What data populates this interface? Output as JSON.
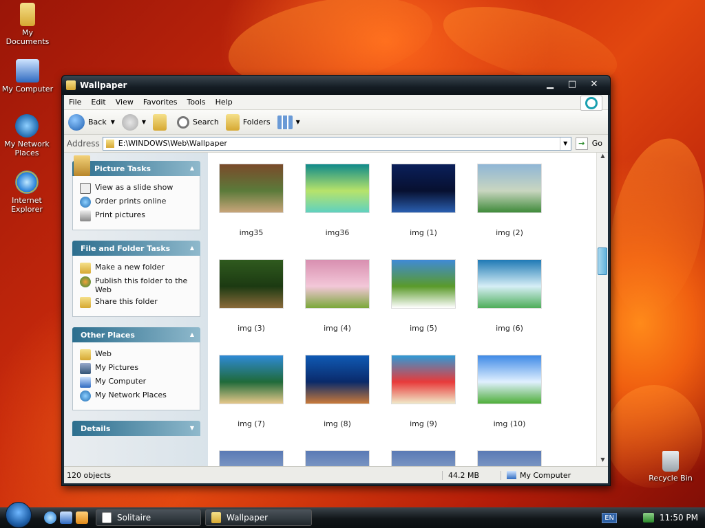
{
  "desktop": {
    "icons": [
      {
        "label": "My Documents",
        "icon": "folder-documents-icon"
      },
      {
        "label": "My Computer",
        "icon": "computer-icon"
      },
      {
        "label": "My Network Places",
        "icon": "network-icon"
      },
      {
        "label": "Internet Explorer",
        "icon": "internet-explorer-icon"
      },
      {
        "label": "Recycle Bin",
        "icon": "recycle-bin-icon"
      }
    ]
  },
  "window": {
    "title": "Wallpaper",
    "controls": {
      "minimize": "▁",
      "maximize": "□",
      "close": "✕"
    }
  },
  "menu": [
    "File",
    "Edit",
    "View",
    "Favorites",
    "Tools",
    "Help"
  ],
  "toolbar": {
    "back": "Back",
    "search": "Search",
    "folders": "Folders"
  },
  "address": {
    "label": "Address",
    "path": "E:\\WINDOWS\\Web\\Wallpaper",
    "go": "Go"
  },
  "panels": {
    "picture_tasks": {
      "title": "Picture Tasks",
      "items": [
        "View as a slide show",
        "Order prints online",
        "Print pictures"
      ]
    },
    "file_folder_tasks": {
      "title": "File and Folder Tasks",
      "items": [
        "Make a new folder",
        "Publish this folder to the Web",
        "Share this folder"
      ]
    },
    "other_places": {
      "title": "Other Places",
      "items": [
        "Web",
        "My Pictures",
        "My Computer",
        "My Network Places"
      ]
    },
    "details": {
      "title": "Details"
    }
  },
  "thumbnails": [
    {
      "name": "img35",
      "colors": [
        "#7a4a2a",
        "#c9a57a",
        "#5b7a3a"
      ]
    },
    {
      "name": "img36",
      "colors": [
        "#0f8a8a",
        "#5fd1c0",
        "#b7e36a"
      ]
    },
    {
      "name": "img (1)",
      "colors": [
        "#0a1f5a",
        "#2a5fb0",
        "#071030"
      ]
    },
    {
      "name": "img (2)",
      "colors": [
        "#8fb6d6",
        "#3f8a3a",
        "#c9d6c0"
      ]
    },
    {
      "name": "img (3)",
      "colors": [
        "#2f5a1e",
        "#8a6a3a",
        "#1c3a12"
      ]
    },
    {
      "name": "img (4)",
      "colors": [
        "#d88fb0",
        "#7aa83a",
        "#f3c7d8"
      ]
    },
    {
      "name": "img (5)",
      "colors": [
        "#3f8ad6",
        "#ffffff",
        "#5a9a2a"
      ]
    },
    {
      "name": "img (6)",
      "colors": [
        "#1f7ab5",
        "#4fae5a",
        "#d6eef6"
      ]
    },
    {
      "name": "img (7)",
      "colors": [
        "#2f8ad6",
        "#e6c88a",
        "#1f6a3a"
      ]
    },
    {
      "name": "img (8)",
      "colors": [
        "#0f5ab5",
        "#c97a3a",
        "#0a2a6a"
      ]
    },
    {
      "name": "img (9)",
      "colors": [
        "#2f9ad6",
        "#f0e8c8",
        "#e83a3a"
      ]
    },
    {
      "name": "img (10)",
      "colors": [
        "#3f8ae6",
        "#4fae3a",
        "#e0f0ff"
      ]
    }
  ],
  "status": {
    "objects": "120 objects",
    "size": "44.2 MB",
    "location": "My Computer"
  },
  "taskbar": {
    "buttons": [
      "Solitaire",
      "Wallpaper"
    ],
    "lang": "EN",
    "time": "11:50 PM"
  }
}
